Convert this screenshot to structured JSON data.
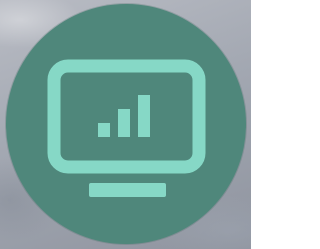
{
  "icon": {
    "name": "monitor-analytics-icon",
    "description_role": "app-launcher-badge"
  },
  "colors": {
    "badge_fill": "#4f877b",
    "glyph_stroke": "#86d8c6",
    "background": "#a3a8b2"
  },
  "bars": [
    0.33,
    0.66,
    1.0
  ]
}
